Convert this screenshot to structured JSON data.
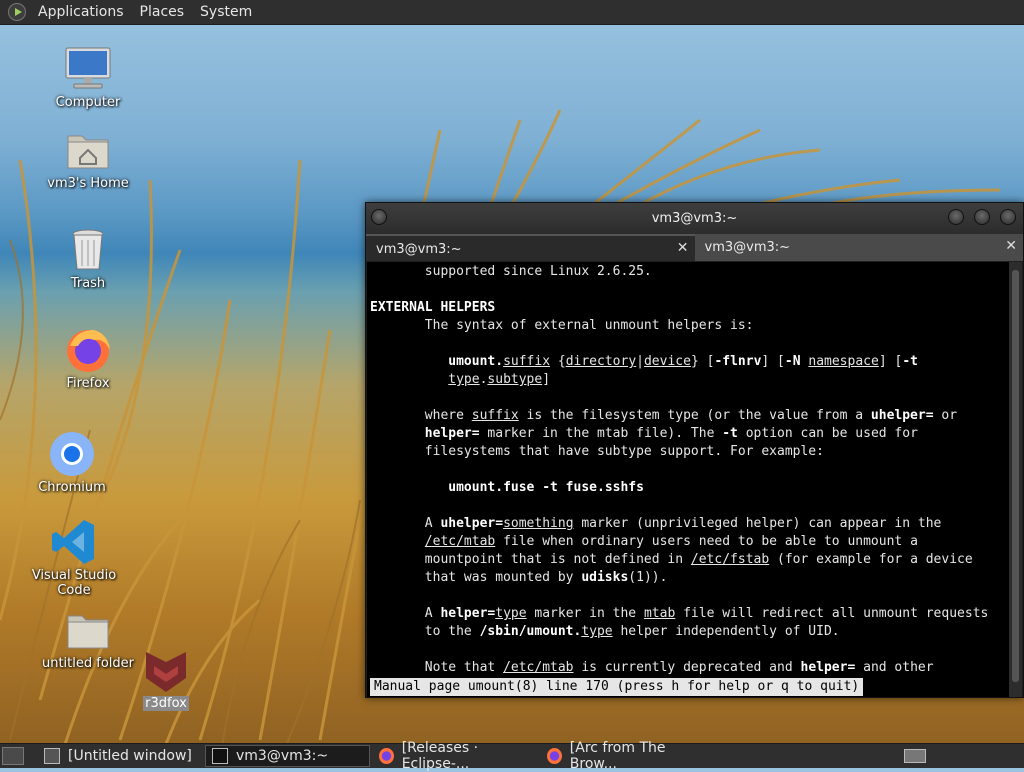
{
  "top_panel": {
    "menus": [
      "Applications",
      "Places",
      "System"
    ]
  },
  "desktop": {
    "icons": [
      {
        "label": "Computer",
        "icon": "computer-icon"
      },
      {
        "label": "vm3's Home",
        "icon": "home-folder-icon"
      },
      {
        "label": "Trash",
        "icon": "trash-icon"
      },
      {
        "label": "Firefox",
        "icon": "firefox-icon"
      },
      {
        "label": "Chromium",
        "icon": "chromium-icon"
      },
      {
        "label": "Visual Studio Code",
        "icon": "vscode-icon"
      },
      {
        "label": "untitled folder",
        "icon": "folder-icon"
      },
      {
        "label": "r3dfox",
        "icon": "r3dfox-icon"
      }
    ]
  },
  "terminal": {
    "title": "vm3@vm3:~",
    "tabs": [
      {
        "label": "vm3@vm3:~",
        "active": true
      },
      {
        "label": "vm3@vm3:~",
        "active": false
      }
    ],
    "close_glyph": "✕",
    "status_line": "Manual page umount(8) line 170 (press h for help or q to quit)"
  },
  "taskbar": {
    "items": [
      {
        "label": "[Untitled window]",
        "icon": "window-icon",
        "active": false
      },
      {
        "label": "vm3@vm3:~",
        "icon": "terminal-icon",
        "active": true
      },
      {
        "label": "[Releases · Eclipse-...",
        "icon": "firefox-icon",
        "active": false
      },
      {
        "label": "[Arc from The Brow...",
        "icon": "firefox-icon",
        "active": false
      }
    ]
  }
}
